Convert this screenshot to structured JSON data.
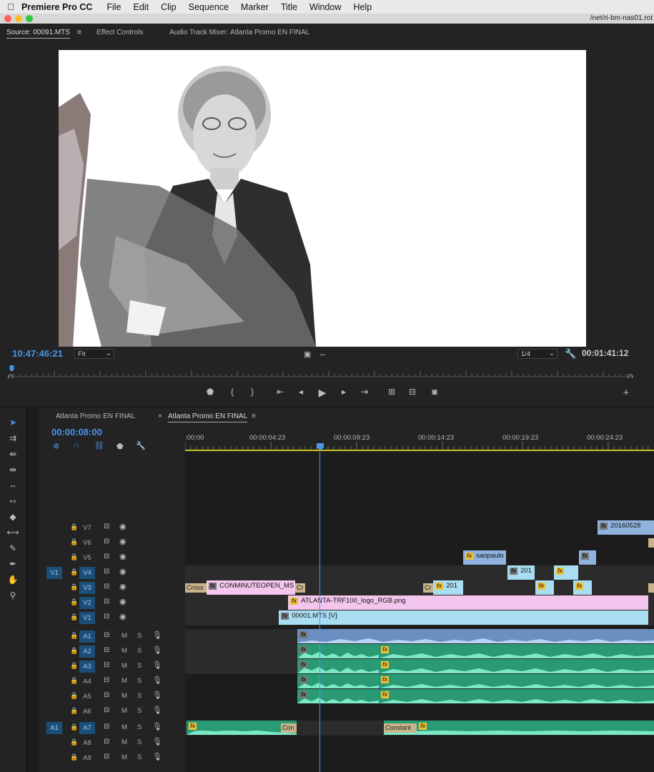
{
  "menubar": {
    "app_name": "Premiere Pro CC",
    "items": [
      "File",
      "Edit",
      "Clip",
      "Sequence",
      "Marker",
      "Title",
      "Window",
      "Help"
    ]
  },
  "titlebar": {
    "path": "/net/ri-bm-nas01.rot"
  },
  "source_panel": {
    "tabs": [
      "Source: 00091.MTS",
      "Effect Controls",
      "Audio Track Mixer: Atlanta Promo EN FINAL"
    ],
    "active_tab": 0,
    "current_timecode": "10:47:46:21",
    "zoom_select": "Fit",
    "resolution_select": "1/4",
    "duration_timecode": "00:01:41:12",
    "playhead_fraction": 0.004
  },
  "timeline": {
    "tabs": [
      "Atlanta Promo EN FINAL",
      "Atlanta Promo EN FINAL"
    ],
    "active_tab": 1,
    "timecode": "00:00:08:00",
    "ruler_labels": [
      ":00:00",
      "00:00:04:23",
      "00:00:09:23",
      "00:00:14:23",
      "00:00:19:23",
      "00:00:24:23"
    ],
    "video_tracks": [
      {
        "name": "V7",
        "targeted": false,
        "source": ""
      },
      {
        "name": "V6",
        "targeted": false,
        "source": ""
      },
      {
        "name": "V5",
        "targeted": false,
        "source": ""
      },
      {
        "name": "V4",
        "targeted": true,
        "source": "V1"
      },
      {
        "name": "V3",
        "targeted": true,
        "source": ""
      },
      {
        "name": "V2",
        "targeted": true,
        "source": ""
      },
      {
        "name": "V1",
        "targeted": true,
        "source": ""
      }
    ],
    "audio_tracks": [
      {
        "name": "A1",
        "targeted": true,
        "source": ""
      },
      {
        "name": "A2",
        "targeted": true,
        "source": ""
      },
      {
        "name": "A3",
        "targeted": true,
        "source": ""
      },
      {
        "name": "A4",
        "targeted": false,
        "source": ""
      },
      {
        "name": "A5",
        "targeted": false,
        "source": ""
      },
      {
        "name": "A6",
        "targeted": false,
        "source": ""
      },
      {
        "name": "A7",
        "targeted": true,
        "source": "A1"
      },
      {
        "name": "A8",
        "targeted": false,
        "source": ""
      },
      {
        "name": "A9",
        "targeted": false,
        "source": ""
      }
    ],
    "track_toggle_m": "M",
    "track_toggle_s": "S",
    "clips": {
      "v7_clip": "20160528",
      "v5_clip": "saopaulo",
      "v4_clip": "201",
      "v3_cross": "Cross",
      "v3_clip": "CONMINUTEOPEN_MS",
      "v3_cr": "Cr",
      "v3_cr2": "Cr",
      "v3_clip2": "201",
      "v2_clip": "ATLANTA-TRF100_logo_RGB.png",
      "v1_clip": "00001.MTS [V]",
      "a7_con": "Con",
      "a7_constant": "Constant"
    },
    "fx_label": "fx"
  }
}
